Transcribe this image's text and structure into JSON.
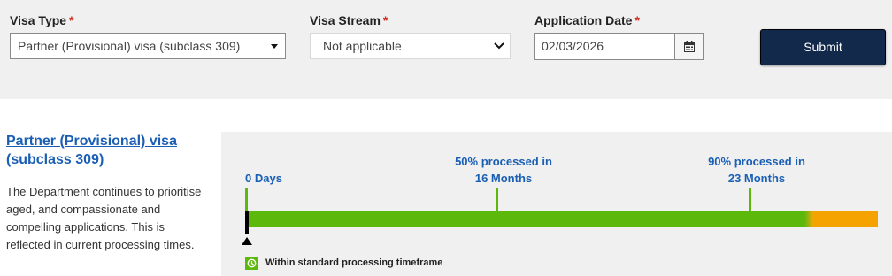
{
  "form": {
    "visa_type": {
      "label": "Visa Type",
      "required_mark": "*",
      "value": "Partner (Provisional) visa (subclass 309)"
    },
    "visa_stream": {
      "label": "Visa Stream",
      "required_mark": "*",
      "value": "Not applicable"
    },
    "application_date": {
      "label": "Application Date",
      "required_mark": "*",
      "value": "02/03/2026"
    },
    "submit_label": "Submit"
  },
  "info": {
    "title": "Partner (Provisional) visa (subclass 309)",
    "description": "The Department continues to prioritise aged, and compassionate and compelling applications. This is reflected in current processing times."
  },
  "timeline": {
    "start_label": "0 Days",
    "milestones": [
      {
        "line1": "50% processed in",
        "line2": "16 Months",
        "months": 16
      },
      {
        "line1": "90% processed in",
        "line2": "23 Months",
        "months": 23
      }
    ],
    "legend_label": "Within standard processing timeframe",
    "colors": {
      "within": "#5cb80b",
      "beyond": "#f5a300",
      "link": "#1a5fb4",
      "submit": "#13294b"
    }
  }
}
